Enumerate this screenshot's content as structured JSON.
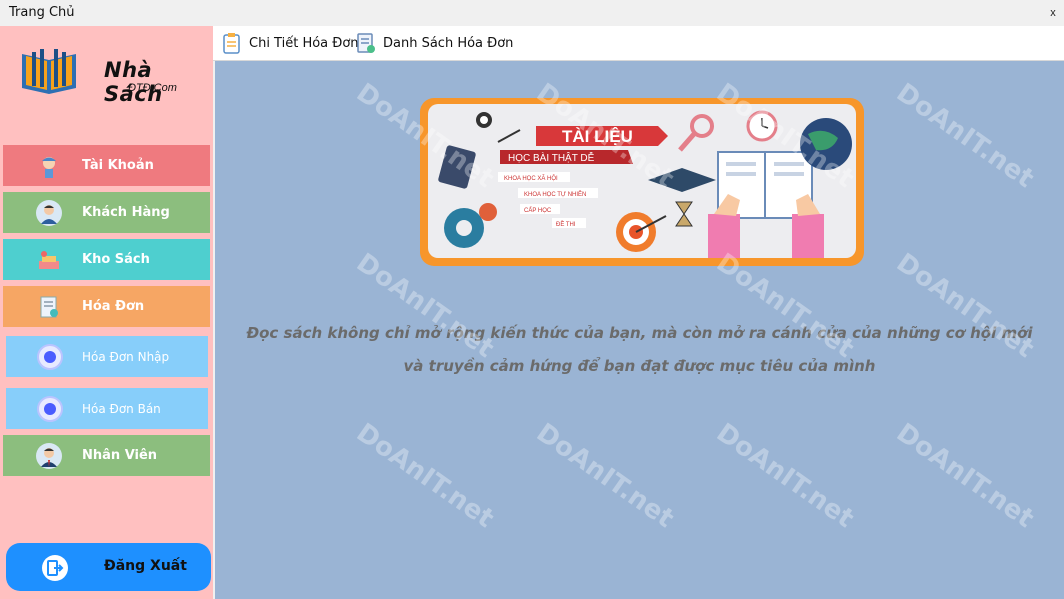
{
  "window": {
    "title": "Trang Chủ",
    "close_label": "x"
  },
  "brand": {
    "name": "Nhà Sách",
    "sub": "ĐTĐ.Com"
  },
  "menu": [
    {
      "label": "Tài Khoản",
      "color": "#ef7a7f",
      "icon": "user-shield-icon"
    },
    {
      "label": "Khách Hàng",
      "color": "#8cbe7e",
      "icon": "customer-icon"
    },
    {
      "label": "Kho Sách",
      "color": "#4ecfcf",
      "icon": "warehouse-icon"
    },
    {
      "label": "Hóa Đơn",
      "color": "#f6a664",
      "icon": "invoice-icon"
    }
  ],
  "submenu": [
    {
      "label": "Hóa Đơn Nhập"
    },
    {
      "label": "Hóa Đơn Bán"
    }
  ],
  "staff": {
    "label": "Nhân Viên",
    "color": "#8cbe7e",
    "icon": "employee-icon"
  },
  "logout": {
    "label": "Đăng Xuất"
  },
  "toolbar": {
    "invoice_detail": "Chi Tiết Hóa Đơn",
    "invoice_list": "Danh Sách Hóa Đơn"
  },
  "banner": {
    "title": "TÀI LIỆU",
    "subtitle": "HỌC BÀI THẬT DỄ",
    "tags": [
      "KHOA HỌC XÃ HỘI",
      "KHOA HỌC TỰ NHIÊN",
      "CẤP HỌC",
      "ĐỀ THI"
    ]
  },
  "quote": {
    "line1": "Đọc sách không chỉ mở rộng kiến thức của bạn, mà còn mở ra cánh cửa của những cơ hội mới",
    "line2": "và truyền cảm hứng để bạn đạt được mục tiêu của mình"
  },
  "watermark": "DoAnIT.net"
}
